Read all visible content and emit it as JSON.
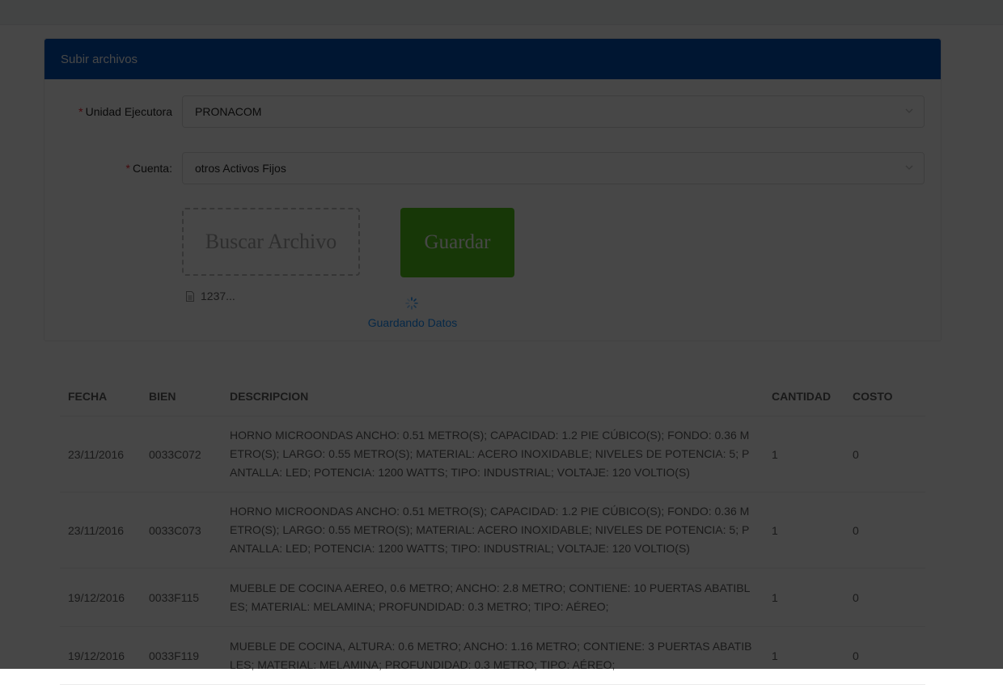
{
  "form": {
    "title": "Subir archivos",
    "required_mark": "*",
    "unidad_label": "Unidad Ejecutora",
    "unidad_value": "PRONACOM",
    "cuenta_label": "Cuenta:",
    "cuenta_value": "otros Activos Fijos",
    "browse_label": "Buscar Archivo",
    "save_label": "Guardar",
    "file_name": "1237...",
    "saving_text": "Guardando Datos"
  },
  "colors": {
    "header_blue": "#0050b3",
    "save_green": "#52c41a",
    "required_red": "#f5222d",
    "saving_blue": "#1890ff",
    "overlay": "rgba(0,0,0,0.72)"
  },
  "table": {
    "headers": {
      "fecha": "FECHA",
      "bien": "BIEN",
      "descripcion": "DESCRIPCION",
      "cantidad": "CANTIDAD",
      "costo": "COSTO"
    },
    "rows": [
      {
        "fecha": "23/11/2016",
        "bien": "0033C072",
        "descripcion": "HORNO MICROONDAS ANCHO: 0.51 METRO(S); CAPACIDAD: 1.2 PIE CÚBICO(S); FONDO: 0.36 METRO(S); LARGO: 0.55 METRO(S); MATERIAL: ACERO INOXIDABLE; NIVELES DE POTENCIA: 5; PANTALLA: LED; POTENCIA: 1200 WATTS; TIPO: INDUSTRIAL; VOLTAJE: 120 VOLTIO(S)",
        "cantidad": "1",
        "costo": "0"
      },
      {
        "fecha": "23/11/2016",
        "bien": "0033C073",
        "descripcion": "HORNO MICROONDAS ANCHO: 0.51 METRO(S); CAPACIDAD: 1.2 PIE CÚBICO(S); FONDO: 0.36 METRO(S); LARGO: 0.55 METRO(S); MATERIAL: ACERO INOXIDABLE; NIVELES DE POTENCIA: 5; PANTALLA: LED; POTENCIA: 1200 WATTS; TIPO: INDUSTRIAL; VOLTAJE: 120 VOLTIO(S)",
        "cantidad": "1",
        "costo": "0"
      },
      {
        "fecha": "19/12/2016",
        "bien": "0033F115",
        "descripcion": "MUEBLE DE COCINA AEREO, 0.6 METRO; ANCHO: 2.8 METRO; CONTIENE: 10 PUERTAS ABATIBLES; MATERIAL: MELAMINA; PROFUNDIDAD: 0.3 METRO; TIPO: AÉREO;",
        "cantidad": "1",
        "costo": "0"
      },
      {
        "fecha": "19/12/2016",
        "bien": "0033F119",
        "descripcion": "MUEBLE DE COCINA, ALTURA: 0.6 METRO; ANCHO: 1.16 METRO; CONTIENE: 3 PUERTAS ABATIBLES; MATERIAL: MELAMINA; PROFUNDIDAD: 0.3 METRO; TIPO: AÉREO;",
        "cantidad": "1",
        "costo": "0"
      }
    ]
  }
}
